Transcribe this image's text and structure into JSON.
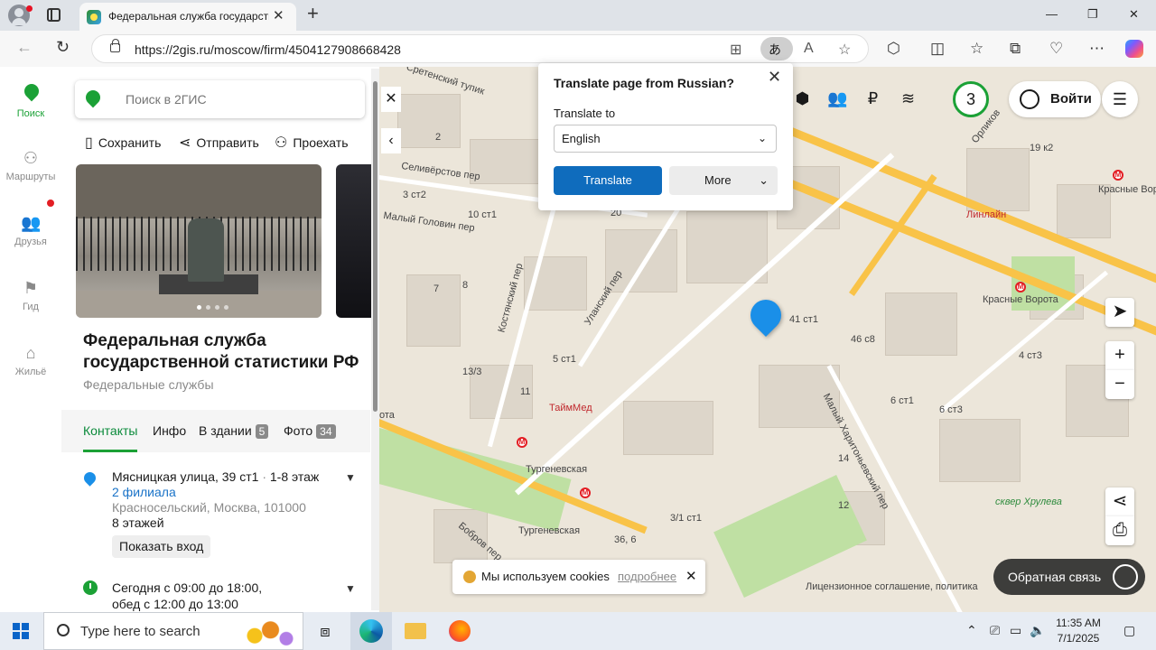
{
  "browser": {
    "tab_title": "Федеральная служба государств",
    "url": "https://2gis.ru/moscow/firm/4504127908668428"
  },
  "rail": {
    "items": [
      {
        "label": "Поиск"
      },
      {
        "label": "Маршруты"
      },
      {
        "label": "Друзья"
      },
      {
        "label": "Гид"
      },
      {
        "label": "Жильё"
      }
    ]
  },
  "panel": {
    "search_placeholder": "Поиск в 2ГИС",
    "actions": {
      "save": "Сохранить",
      "share": "Отправить",
      "route": "Проехать"
    },
    "name": "Федеральная служба государственной статистики РФ",
    "category": "Федеральные службы",
    "tabs": {
      "contacts": "Контакты",
      "info": "Инфо",
      "in_building": "В здании",
      "in_building_count": "5",
      "photo": "Фото",
      "photo_count": "34"
    },
    "address": {
      "street": "Мясницкая улица, 39 ст1",
      "floor": "1-8 этаж",
      "branches": "2 филиала",
      "district": "Красносельский, Москва, 101000",
      "floors_total": "8 этажей",
      "entrance_button": "Показать вход"
    },
    "hours": {
      "today": "Сегодня с 09:00 до 18:00,",
      "lunch": "обед с 12:00 до 13:00"
    }
  },
  "map": {
    "login": "Войти",
    "counter": "3",
    "labels": {
      "sretensky": "Сретенский тупик",
      "seliverstov": "Селивёрстов пер",
      "golovin": "Малый Головин пер",
      "kostyansky": "Костянский пер",
      "ulansky": "Уланский пер",
      "taimmed": "ТаймМед",
      "turgenevskaya1": "Тургеневская",
      "turgenevskaya2": "Тургеневская",
      "bobrov": "Бобров пер",
      "kharitonievsky": "Малый Харитоньевский пер",
      "krasnye_vorota1": "Красные Ворота",
      "krasnye_vorota2": "Красные Ворота",
      "linialine": "Линлайн",
      "orlikov": "Орликов",
      "khrulev": "сквер Хрулева",
      "ulitsa_part": "ота"
    },
    "numbers": {
      "n20": "20",
      "n2": "2",
      "n3s12": "3 ст2",
      "n10s1": "10 ст1",
      "n7": "7",
      "n8": "8",
      "n13s3": "13/3",
      "n11": "11",
      "n5s1": "5 ст1",
      "n41s1": "41 ст1",
      "n46s8": "46 с8",
      "n6s1": "6 ст1",
      "n6s3": "6 ст3",
      "n4s3": "4 ст3",
      "n19k2": "19 к2",
      "n14": "14",
      "n12": "12",
      "n3s1": "3/1 ст1",
      "n36": "36, 6"
    },
    "cookie_text": "Мы используем cookies",
    "cookie_link": "подробнее",
    "feedback": "Обратная связь",
    "license": "Лицензионное соглашение, политика"
  },
  "translate_popup": {
    "title": "Translate page from Russian?",
    "translate_to_label": "Translate to",
    "language": "English",
    "translate_button": "Translate",
    "more_button": "More"
  },
  "taskbar": {
    "search_placeholder": "Type here to search",
    "time": "11:35 AM",
    "date": "7/1/2025"
  }
}
